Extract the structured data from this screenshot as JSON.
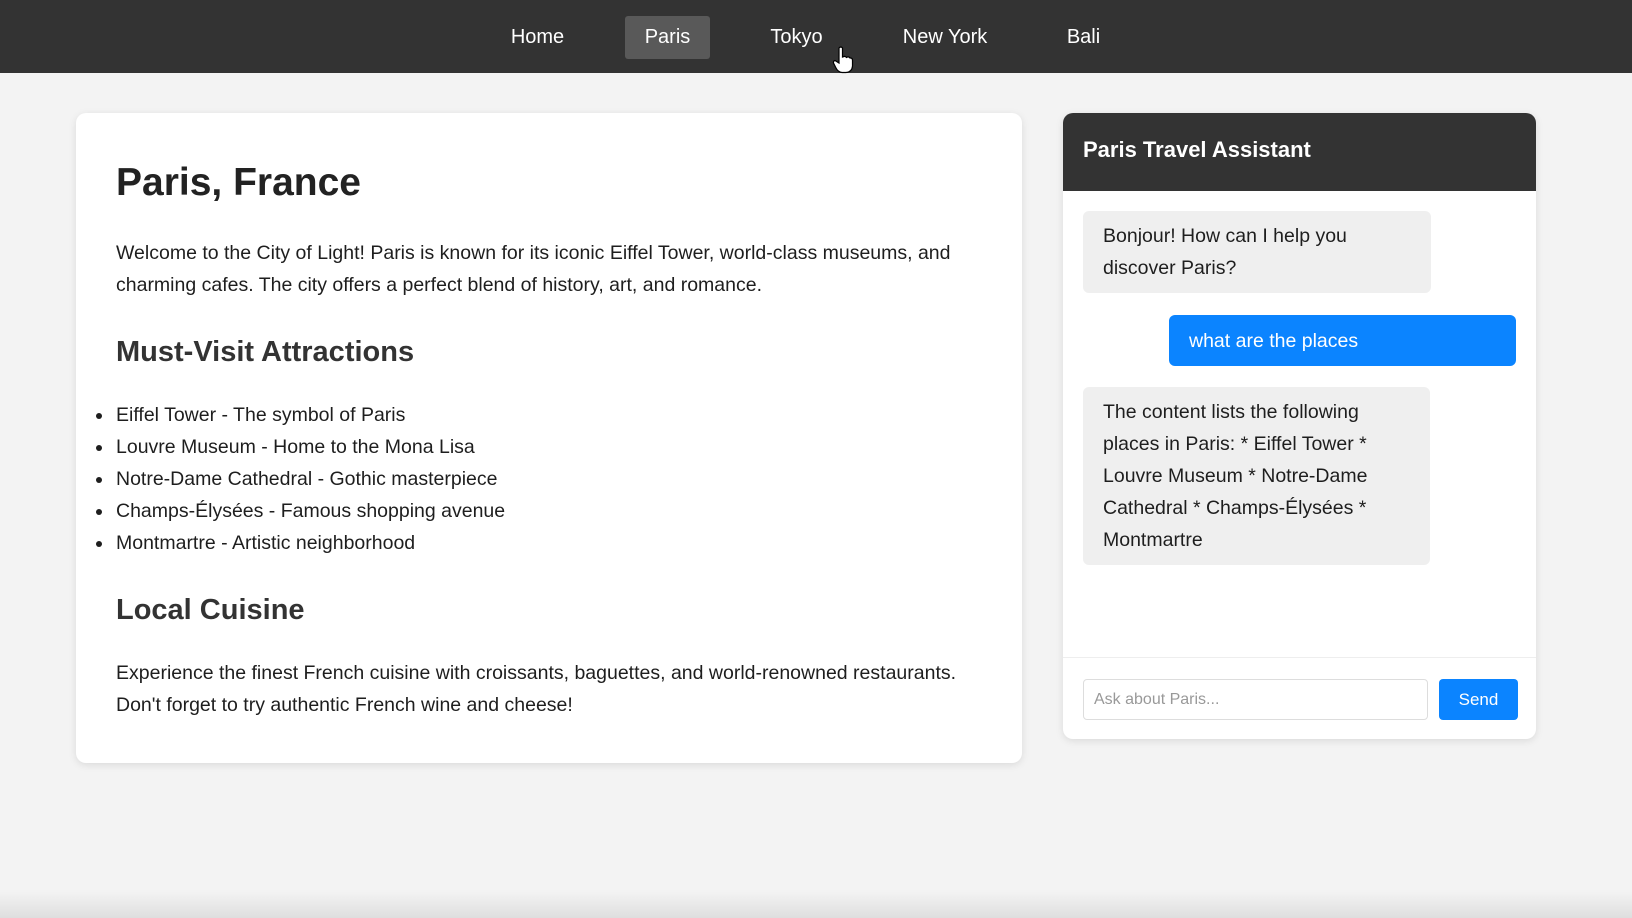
{
  "nav": {
    "items": [
      {
        "label": "Home",
        "active": false
      },
      {
        "label": "Paris",
        "active": true
      },
      {
        "label": "Tokyo",
        "active": false
      },
      {
        "label": "New York",
        "active": false
      },
      {
        "label": "Bali",
        "active": false
      }
    ]
  },
  "main": {
    "title": "Paris, France",
    "intro": "Welcome to the City of Light! Paris is known for its iconic Eiffel Tower, world-class museums, and charming cafes. The city offers a perfect blend of history, art, and romance.",
    "attractions_heading": "Must-Visit Attractions",
    "attractions": [
      "Eiffel Tower - The symbol of Paris",
      "Louvre Museum - Home to the Mona Lisa",
      "Notre-Dame Cathedral - Gothic masterpiece",
      "Champs-Élysées - Famous shopping avenue",
      "Montmartre - Artistic neighborhood"
    ],
    "cuisine_heading": "Local Cuisine",
    "cuisine_text": "Experience the finest French cuisine with croissants, baguettes, and world-renowned restaurants. Don't forget to try authentic French wine and cheese!"
  },
  "chat": {
    "title": "Paris Travel Assistant",
    "messages": [
      {
        "role": "bot",
        "text": "Bonjour! How can I help you discover Paris?"
      },
      {
        "role": "user",
        "text": "what are the places"
      },
      {
        "role": "bot",
        "text": "The content lists the following places in Paris: * Eiffel Tower * Louvre Museum * Notre-Dame Cathedral * Champs-Élysées * Montmartre"
      }
    ],
    "input_placeholder": "Ask about Paris...",
    "input_value": "",
    "send_label": "Send"
  },
  "colors": {
    "nav_bg": "#333333",
    "nav_active": "#595959",
    "accent": "#0b84ff",
    "page_bg": "#f3f3f3"
  }
}
